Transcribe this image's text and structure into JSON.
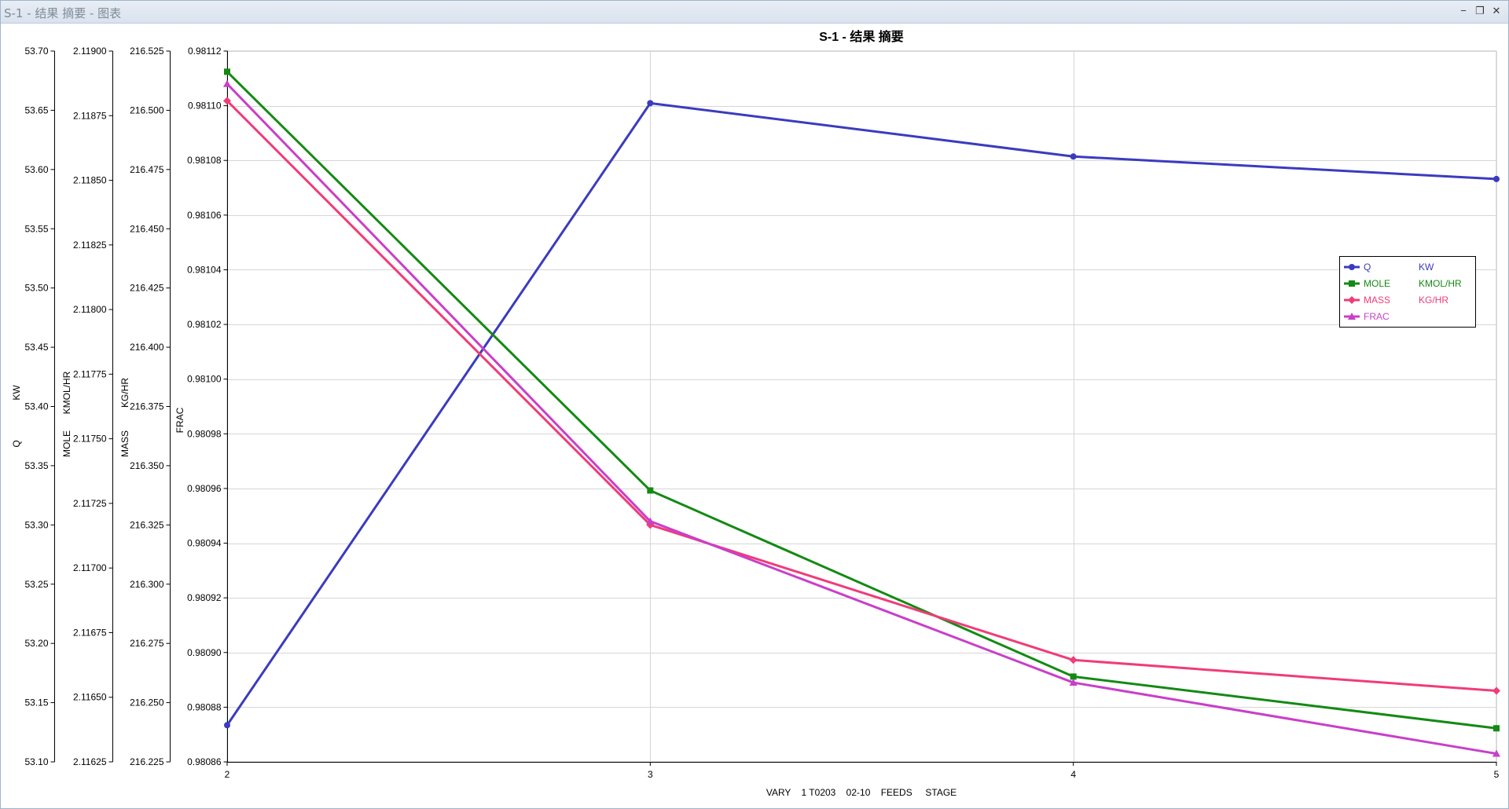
{
  "window": {
    "title": "S-1 - 结果 摘要 - 图表",
    "minimize_glyph": "−",
    "restore_glyph": "❐",
    "close_glyph": "✕"
  },
  "chart_data": {
    "type": "line",
    "title": "S-1 - 结果 摘要",
    "xlabel": "VARY    1 T0203    02-10    FEEDS     STAGE",
    "x": [
      2,
      3,
      4,
      5
    ],
    "xlim": [
      2,
      5
    ],
    "x_ticks": [
      "2",
      "3",
      "4",
      "5"
    ],
    "grid": true,
    "legend_position": "right",
    "axes": [
      {
        "id": "q",
        "label_top": "KW",
        "label_bottom": "Q",
        "ylim": [
          53.1,
          53.7
        ],
        "ticks": [
          "53.10",
          "53.15",
          "53.20",
          "53.25",
          "53.30",
          "53.35",
          "53.40",
          "53.45",
          "53.50",
          "53.55",
          "53.60",
          "53.65",
          "53.70"
        ]
      },
      {
        "id": "mole",
        "label_top": "KMOL/HR",
        "label_bottom": "MOLE",
        "ylim": [
          2.11625,
          2.119
        ],
        "ticks": [
          "2.11625",
          "2.11650",
          "2.11675",
          "2.11700",
          "2.11725",
          "2.11750",
          "2.11775",
          "2.11800",
          "2.11825",
          "2.11850",
          "2.11875",
          "2.11900"
        ]
      },
      {
        "id": "mass",
        "label_top": "KG/HR",
        "label_bottom": "MASS",
        "ylim": [
          216.225,
          216.525
        ],
        "ticks": [
          "216.225",
          "216.250",
          "216.275",
          "216.300",
          "216.325",
          "216.350",
          "216.375",
          "216.400",
          "216.425",
          "216.450",
          "216.475",
          "216.500",
          "216.525"
        ]
      },
      {
        "id": "frac",
        "label_top": "",
        "label_bottom": "FRAC",
        "ylim": [
          0.98086,
          0.98112
        ],
        "ticks": [
          "0.98086",
          "0.98088",
          "0.98090",
          "0.98092",
          "0.98094",
          "0.98096",
          "0.98098",
          "0.98100",
          "0.98102",
          "0.98104",
          "0.98106",
          "0.98108",
          "0.98110",
          "0.98112"
        ]
      }
    ],
    "series": [
      {
        "name": "Q",
        "unit": "KW",
        "axis": "q",
        "color": "#3b3bbf",
        "marker": "circle",
        "values": [
          53.131,
          53.656,
          53.611,
          53.592
        ]
      },
      {
        "name": "MOLE",
        "unit": "KMOL/HR",
        "axis": "mole",
        "color": "#138a13",
        "marker": "square",
        "values": [
          2.11892,
          2.1173,
          2.11658,
          2.11638
        ]
      },
      {
        "name": "MASS",
        "unit": "KG/HR",
        "axis": "mass",
        "color": "#f03c78",
        "marker": "diamond",
        "values": [
          216.504,
          216.325,
          216.268,
          216.255
        ]
      },
      {
        "name": "FRAC",
        "unit": "",
        "axis": "frac",
        "color": "#c93fc9",
        "marker": "triangle",
        "values": [
          0.981108,
          0.980948,
          0.980889,
          0.980863
        ]
      }
    ]
  }
}
